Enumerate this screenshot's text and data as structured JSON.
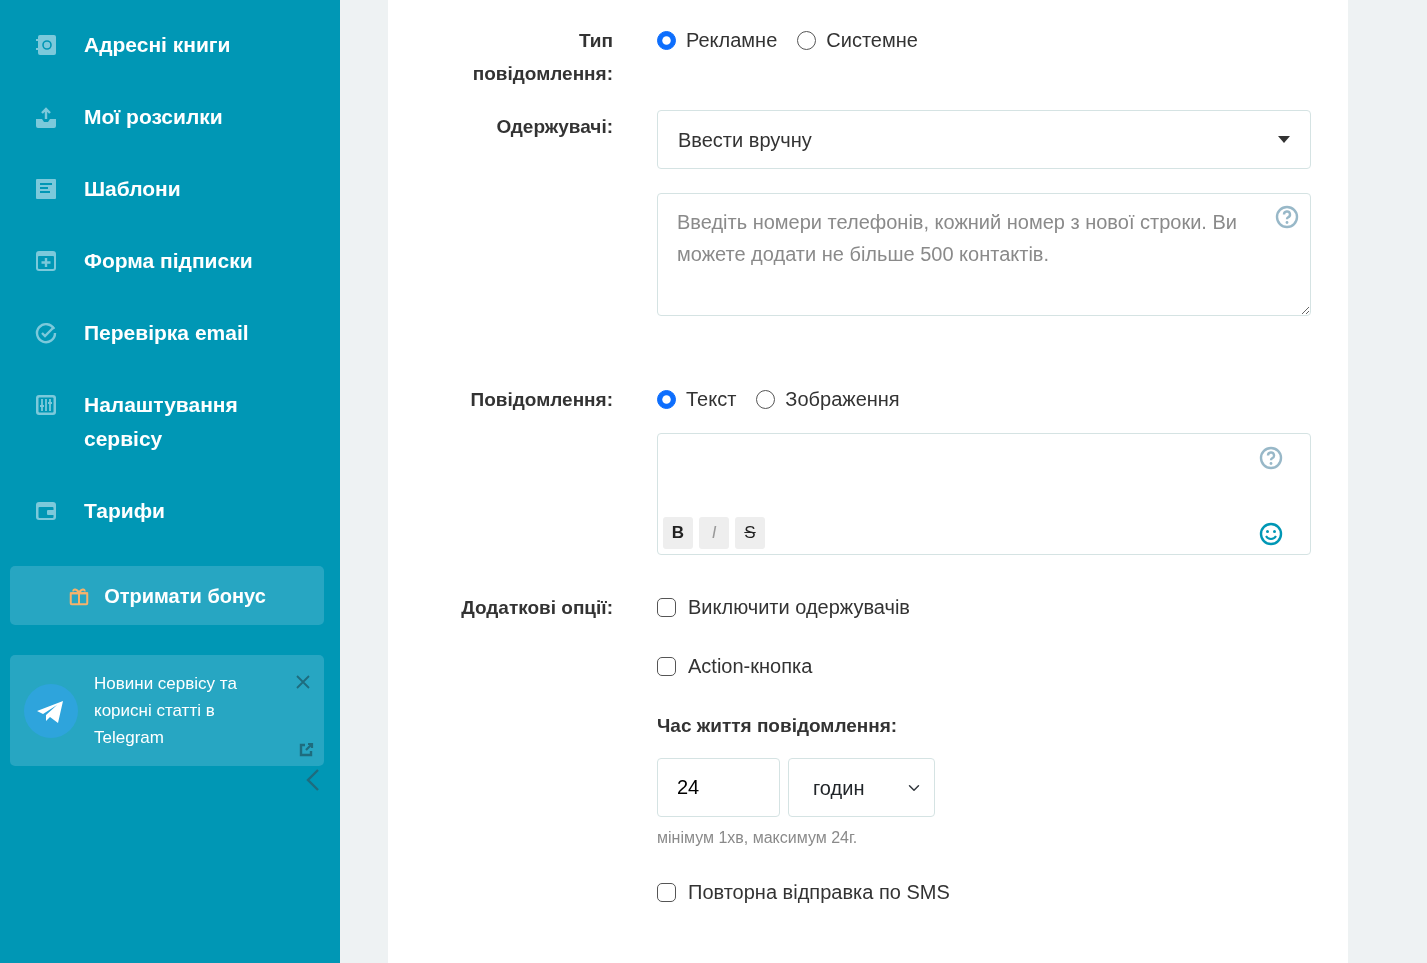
{
  "sidebar": {
    "items": [
      {
        "label": "Адресні книги"
      },
      {
        "label": "Мої розсилки"
      },
      {
        "label": "Шаблони"
      },
      {
        "label": "Форма підписки"
      },
      {
        "label": "Перевірка email"
      },
      {
        "label": "Налаштування сервісу"
      },
      {
        "label": "Тарифи"
      }
    ],
    "bonus_button": "Отримати бонус",
    "telegram_card": {
      "text": "Новини сервісу та корисні статті в Telegram"
    }
  },
  "form": {
    "message_type": {
      "label": "Тип повідомлення:",
      "options": [
        {
          "label": "Рекламне",
          "selected": true
        },
        {
          "label": "Системне",
          "selected": false
        }
      ]
    },
    "recipients": {
      "label": "Одержувачі:",
      "select_value": "Ввести вручну",
      "placeholder": "Введіть номери телефонів, кожний номер з нової строки. Ви можете додати не більше 500 контактів."
    },
    "message": {
      "label": "Повідомлення:",
      "options": [
        {
          "label": "Текст",
          "selected": true
        },
        {
          "label": "Зображення",
          "selected": false
        }
      ],
      "toolbar": [
        {
          "label": "B",
          "kind": "bold"
        },
        {
          "label": "I",
          "kind": "italic"
        },
        {
          "label": "S",
          "kind": "strike"
        }
      ]
    },
    "extra_options": {
      "label": "Додаткові опції:",
      "items": [
        {
          "kind": "checkbox",
          "label": "Виключити одержувачів",
          "checked": false
        },
        {
          "kind": "checkbox",
          "label": "Action-кнопка",
          "checked": false
        },
        {
          "kind": "lifetime",
          "label": "Час життя повідомлення:",
          "value": "24",
          "unit": "годин",
          "hint": "мінімум 1хв, максимум 24г."
        },
        {
          "kind": "checkbox",
          "label": "Повторна відправка по SMS",
          "checked": false
        }
      ]
    }
  }
}
